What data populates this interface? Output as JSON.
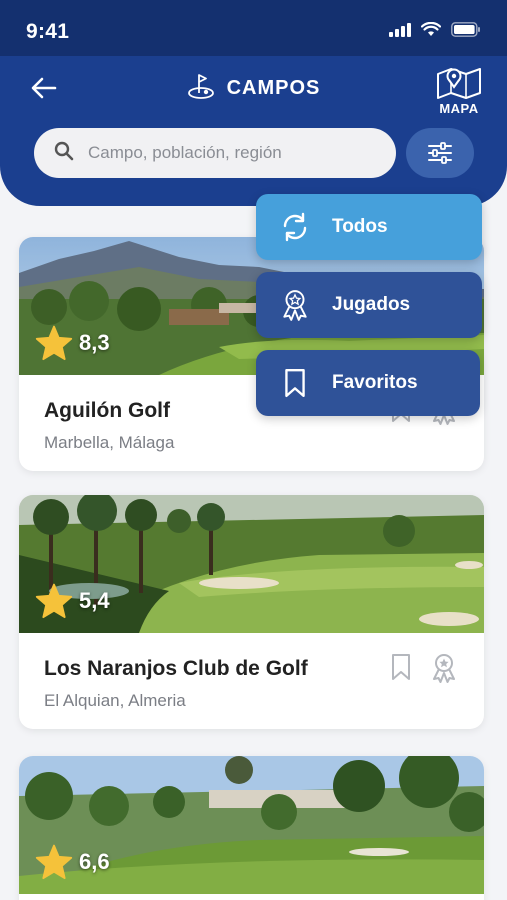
{
  "status_bar": {
    "time": "9:41"
  },
  "header": {
    "title": "CAMPOS",
    "map_label": "MAPA"
  },
  "search": {
    "placeholder": "Campo, población, región"
  },
  "filter_menu": {
    "items": [
      {
        "label": "Todos",
        "icon": "refresh-icon",
        "active": true
      },
      {
        "label": "Jugados",
        "icon": "award-icon",
        "active": false
      },
      {
        "label": "Favoritos",
        "icon": "bookmark-icon",
        "active": false
      }
    ]
  },
  "courses": [
    {
      "name": "Aguilón Golf",
      "location": "Marbella, Málaga",
      "rating": "8,3"
    },
    {
      "name": "Los Naranjos Club de Golf",
      "location": "El Alquian, Almeria",
      "rating": "5,4"
    },
    {
      "name": "",
      "location": "",
      "rating": "6,6"
    }
  ],
  "colors": {
    "header": "#1b3f8f",
    "status_bar": "#14306f",
    "active_menu": "#46a0db",
    "menu": "#2f5298",
    "star": "#f5c23a"
  }
}
